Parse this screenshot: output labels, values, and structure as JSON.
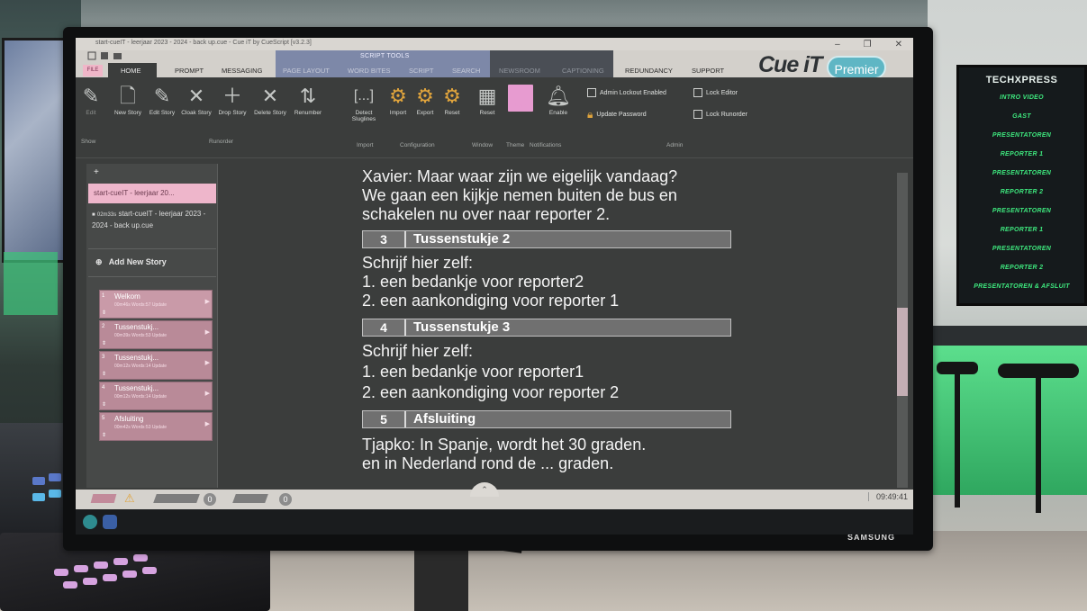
{
  "window": {
    "title": "start-cueIT - leerjaar 2023 - 2024 - back up.cue - Cue iT by CueScript [v3.2.3]",
    "minimize": "–",
    "maximize": "❐",
    "close": "✕"
  },
  "ribbon_tabs": {
    "file": "FILE",
    "home": "HOME",
    "prompt": "PROMPT",
    "messaging": "MESSAGING",
    "script_tools": "SCRIPT TOOLS",
    "page_layout": "PAGE LAYOUT",
    "word_bites": "WORD BITES",
    "script": "SCRIPT",
    "search": "SEARCH",
    "newsroom": "NEWSROOM",
    "captioning": "CAPTIONING",
    "redundancy": "REDUNDANCY",
    "support": "SUPPORT"
  },
  "logo": {
    "cue": "Cue iT",
    "premier": "Premier"
  },
  "ribbon": {
    "edit": "Edit",
    "new_story": "New Story",
    "edit_story": "Edit Story",
    "cloak_story": "Cloak Story",
    "drop_story": "Drop Story",
    "delete_story": "Delete Story",
    "renumber": "Renumber",
    "detect_sluglines": "Detect\nSluglines",
    "import": "Import",
    "export": "Export",
    "reset_config": "Reset",
    "reset_window": "Reset",
    "theme_btn": "Dark",
    "enable": "Enable",
    "admin_lockout": "Admin Lockout Enabled",
    "update_password": "Update Password",
    "lock_editor": "Lock Editor",
    "lock_rundown": "Lock Runorder",
    "groups": {
      "show": "Show",
      "runorder": "Runorder",
      "import": "Import",
      "configuration": "Configuration",
      "window": "Window",
      "theme": "Theme",
      "notifications": "Notifications",
      "admin": "Admin"
    }
  },
  "left_panel": {
    "plus": "+",
    "doc_name": "start-cueIT - leerjaar 20...",
    "duration": "02m33s",
    "doc_full": "start-cueIT - leerjaar 2023 - 2024 - back up.cue",
    "add_new_story": "Add New Story",
    "stories": [
      {
        "num": "1",
        "name": "Welkom",
        "meta": "00m46s Words:57 Update"
      },
      {
        "num": "2",
        "name": "Tussenstukj...",
        "meta": "00m39s Words:53 Update"
      },
      {
        "num": "3",
        "name": "Tussenstukj...",
        "meta": "00m12s Words:14 Update"
      },
      {
        "num": "4",
        "name": "Tussenstukj...",
        "meta": "00m12s Words:14 Update"
      },
      {
        "num": "5",
        "name": "Afsluiting",
        "meta": "00m42s Words:53 Update"
      }
    ]
  },
  "prompt": {
    "intro_lines": [
      "Xavier: Maar waar zijn we eigelijk vandaag?",
      "We gaan een kijkje nemen buiten de bus en",
      "schakelen nu over naar reporter 2."
    ],
    "markers": [
      {
        "num": "3",
        "title": "Tussenstukje 2"
      },
      {
        "num": "4",
        "title": "Tussenstukje 3"
      },
      {
        "num": "5",
        "title": "Afsluiting"
      }
    ],
    "block2": [
      "Schrijf hier zelf:",
      "1. een bedankje voor reporter2",
      "2. een aankondiging voor reporter 1"
    ],
    "block3": [
      "Schrijf hier zelf:",
      "1. een bedankje voor reporter1",
      "2. een aankondiging voor reporter 2"
    ],
    "block5": [
      "Tjapko: In Spanje, wordt het 30 graden.",
      "en in Nederland rond de ... graden."
    ]
  },
  "statusbar": {
    "count1": "0",
    "count2": "0",
    "clock": "09:49:41",
    "expand": "⌃"
  },
  "monitor_brand": "SAMSUNG",
  "backdrop_screen": {
    "title": "TECHXPRESS",
    "items": [
      "INTRO VIDEO",
      "GAST",
      "PRESENTATOREN",
      "REPORTER 1",
      "PRESENTATOREN",
      "REPORTER 2",
      "PRESENTATOREN",
      "REPORTER 1",
      "PRESENTATOREN",
      "REPORTER 2",
      "PRESENTATOREN & AFSLUIT"
    ]
  },
  "colors": {
    "accent_pink": "#eeb6cb",
    "script_tools_band": "#7d88a8",
    "prompt_bg": "#3b3d3c",
    "neon_green": "#3ee87e"
  }
}
